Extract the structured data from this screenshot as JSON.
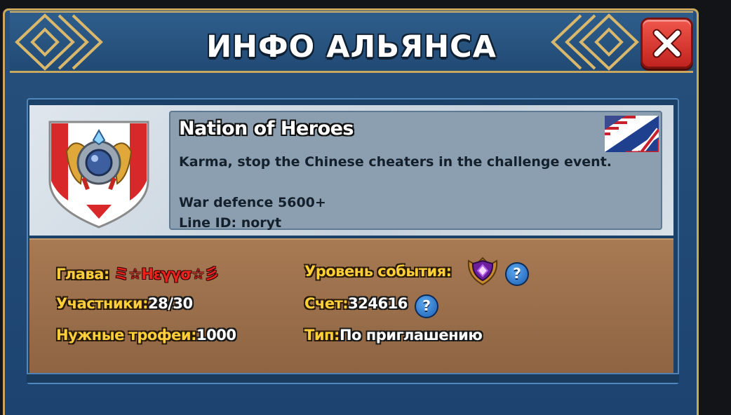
{
  "window": {
    "title": "ИНФО АЛЬЯНСА",
    "close_icon": "close-x-icon"
  },
  "alliance": {
    "name": "Nation of Heroes",
    "flag_icon": "us-uk-flag-icon",
    "emblem_icon": "alliance-shield-emblem-icon",
    "description": [
      "Karma, stop the Chinese cheaters in the challenge event.",
      "",
      "War defence 5600+",
      "Line ID: noryt"
    ]
  },
  "stats": {
    "leader_label": "Глава:",
    "leader_value": "ミ☆Hεγγσ☆彡",
    "members_label": "Участники:",
    "members_value": "28/30",
    "trophies_label": "Нужные трофеи:",
    "trophies_value": "1000",
    "event_level_label": "Уровень события:",
    "event_level_icon": "purple-gem-crest-icon",
    "score_label": "Счет:",
    "score_value": "324616",
    "type_label": "Тип:",
    "type_value": "По приглашению",
    "help_glyph": "?"
  },
  "colors": {
    "label_yellow": "#ffcf3a",
    "leader_red": "#e8231c",
    "frame_gold": "#c9a75e",
    "panel_blue": "#1d4470",
    "stats_brown": "#a77a53"
  }
}
